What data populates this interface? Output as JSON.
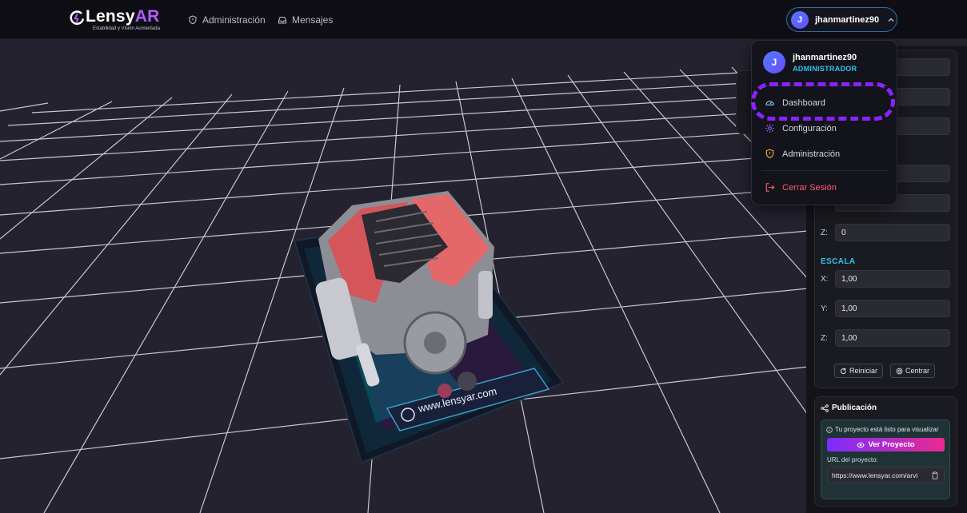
{
  "brand": {
    "name_part1": "Lensy",
    "name_part2": "AR",
    "tagline": "Estabilidad y Visión Aumentada"
  },
  "nav": {
    "items": [
      {
        "label": "Administración",
        "icon": "shield-icon"
      },
      {
        "label": "Mensajes",
        "icon": "inbox-icon"
      }
    ]
  },
  "user": {
    "initial": "J",
    "username": "jhanmartinez90",
    "role": "ADMINISTRADOR"
  },
  "dropdown": {
    "items": [
      {
        "label": "Dashboard",
        "icon": "gauge-icon"
      },
      {
        "label": "Configuración",
        "icon": "gear-icon"
      },
      {
        "label": "Administración",
        "icon": "shield-icon"
      }
    ],
    "logout_label": "Cerrar Sesión"
  },
  "transform": {
    "rotation_z": "0",
    "scale_title": "ESCALA",
    "scale": [
      {
        "axis": "X:",
        "value": "1,00"
      },
      {
        "axis": "Y:",
        "value": "1,00"
      },
      {
        "axis": "Z:",
        "value": "1,00"
      }
    ],
    "z_label": "Z:",
    "reset_label": "Reiniciar",
    "center_label": "Centrar"
  },
  "publication": {
    "title": "Publicación",
    "message": "Tu proyecto está listo para visualizar",
    "view_button": "Ver Proyecto",
    "url_label": "URL del proyecto:",
    "url_value": "https://www.lensyar.com/arvi"
  },
  "scene": {
    "marker_url": "www.lensyar.com"
  },
  "colors": {
    "accent_purple": "#8a22ff",
    "accent_cyan": "#2ec4f0",
    "danger": "#ff5f6d"
  }
}
